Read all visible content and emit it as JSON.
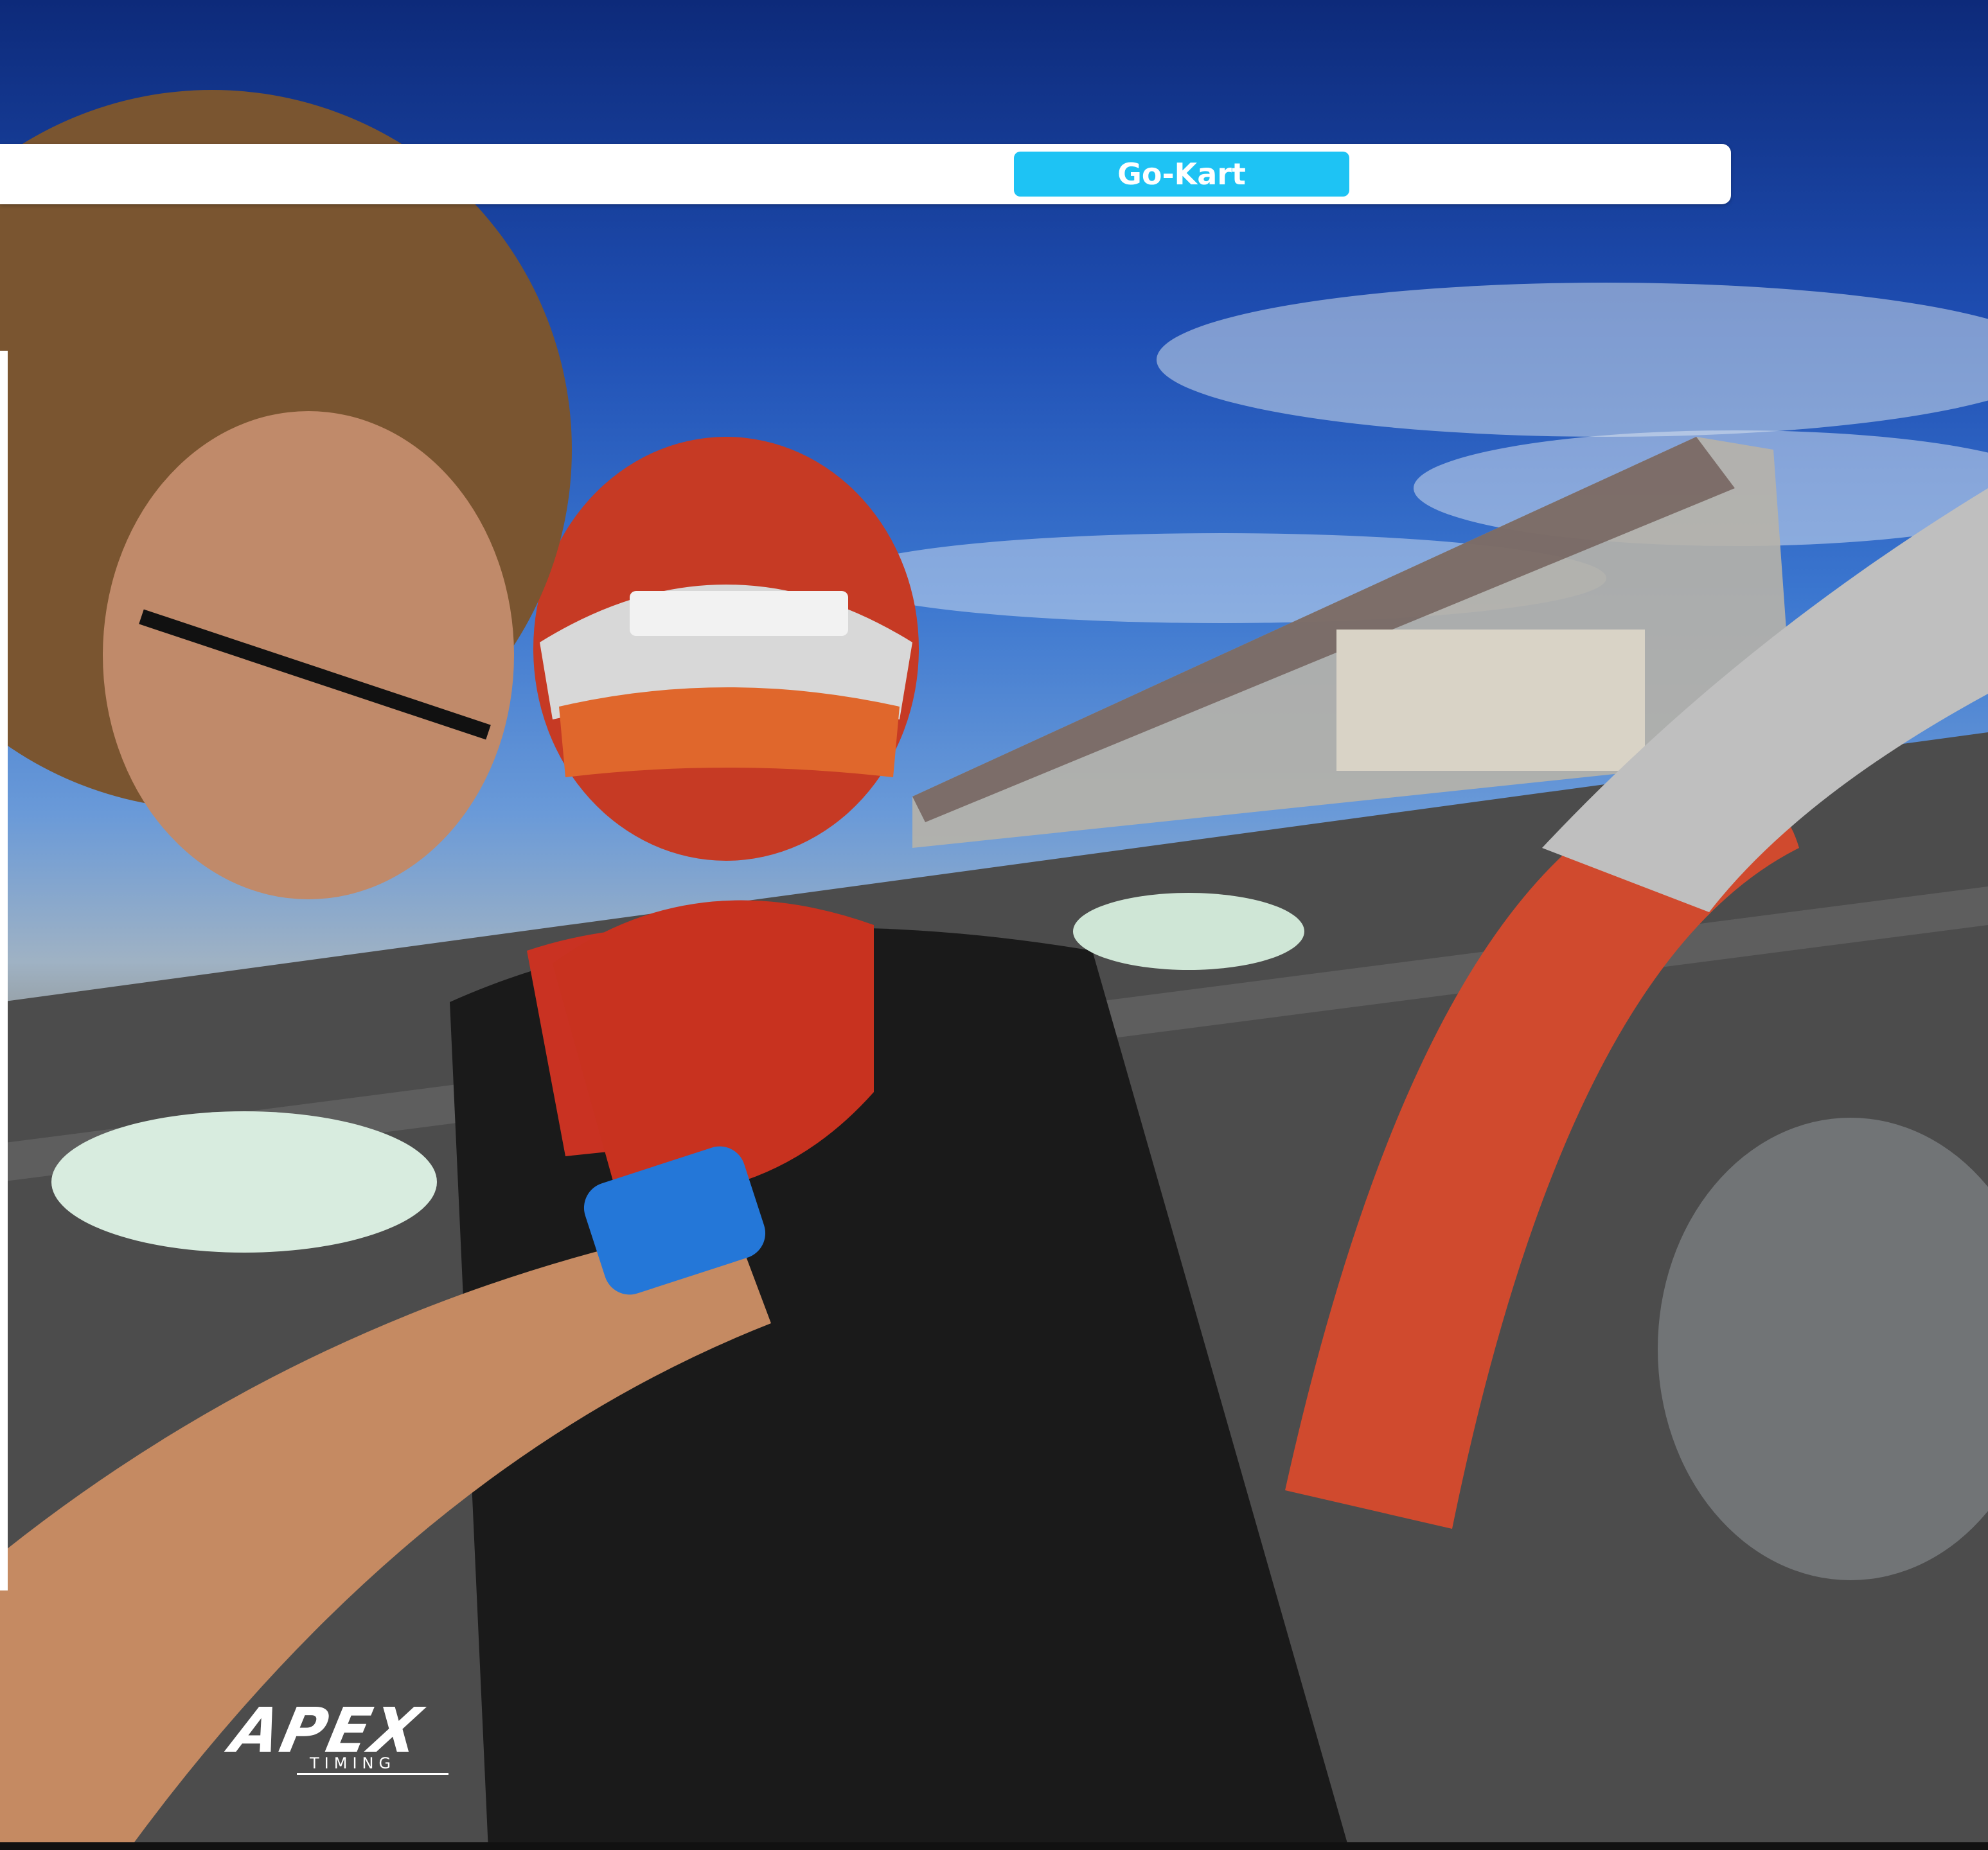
{
  "nav": {
    "active_tab": "Go-Kart"
  },
  "logo": {
    "brand": "APEX",
    "sub": "TIMING"
  },
  "colors": {
    "accent": "#1ec3f4",
    "bar_background": "#ffffff"
  },
  "icons": [
    "apex-timing-logo"
  ]
}
